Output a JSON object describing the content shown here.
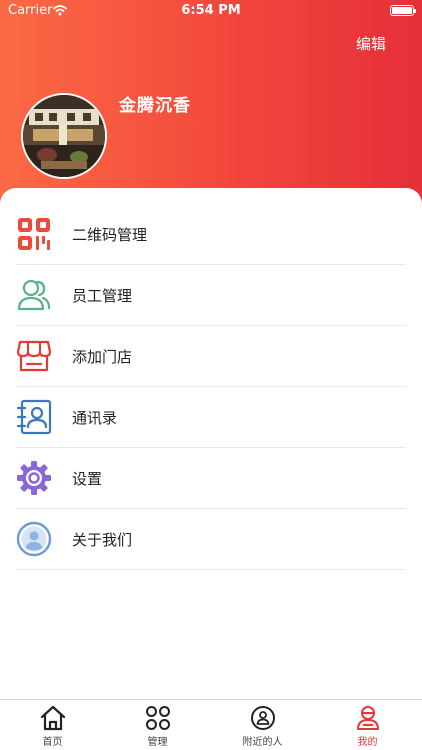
{
  "status": {
    "carrier": "Carrier",
    "time": "6:54 PM"
  },
  "header": {
    "edit_label": "编辑",
    "store_name": "金腾沉香"
  },
  "menu": [
    {
      "label": "二维码管理",
      "icon": "qr-code-icon"
    },
    {
      "label": "员工管理",
      "icon": "staff-icon"
    },
    {
      "label": "添加门店",
      "icon": "store-icon"
    },
    {
      "label": "通讯录",
      "icon": "contacts-icon"
    },
    {
      "label": "设置",
      "icon": "gear-icon"
    },
    {
      "label": "关于我们",
      "icon": "about-icon"
    }
  ],
  "tabs": [
    {
      "label": "首页",
      "icon": "home-icon",
      "active": false
    },
    {
      "label": "管理",
      "icon": "manage-icon",
      "active": false
    },
    {
      "label": "附近的人",
      "icon": "nearby-icon",
      "active": false
    },
    {
      "label": "我的",
      "icon": "profile-icon",
      "active": true
    }
  ],
  "colors": {
    "accent": "#e8353b",
    "header_gradient_start": "#fb6a44",
    "header_gradient_end": "#e52f38",
    "staff_icon": "#5bb08c",
    "contacts_icon": "#3a78c2",
    "gear_icon": "#8868d8",
    "about_icon": "#6a9ad8"
  }
}
